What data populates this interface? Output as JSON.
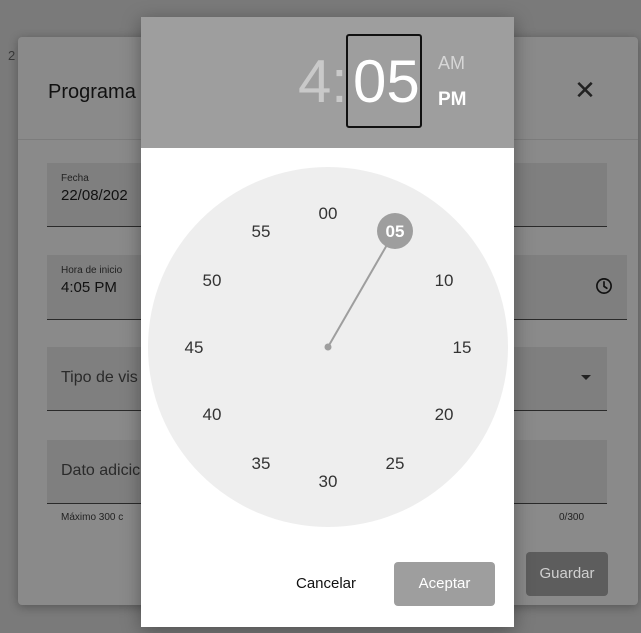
{
  "dialog": {
    "title": "Programa",
    "close_icon": "close-icon",
    "date_field": {
      "label": "Fecha",
      "value": "22/08/202"
    },
    "start_time_field": {
      "label": "Hora de inicio",
      "value": "4:05 PM",
      "icon": "clock-icon"
    },
    "visit_type_field": {
      "placeholder": "Tipo de vis"
    },
    "additional_field": {
      "placeholder": "Dato adicic"
    },
    "helper_text": "Máximo 300 c",
    "counter": "0/300",
    "save_label": "Guardar"
  },
  "time_picker": {
    "hour": "4",
    "colon": ":",
    "minute": "05",
    "am_label": "AM",
    "pm_label": "PM",
    "selected_period": "PM",
    "selected_minute": 5,
    "minute_labels": [
      "00",
      "05",
      "10",
      "15",
      "20",
      "25",
      "30",
      "35",
      "40",
      "45",
      "50",
      "55"
    ],
    "cancel_label": "Cancelar",
    "accept_label": "Aceptar"
  },
  "colors": {
    "header": "#9e9e9e",
    "dial_face": "#eeeeee",
    "selected": "#9e9e9e"
  }
}
